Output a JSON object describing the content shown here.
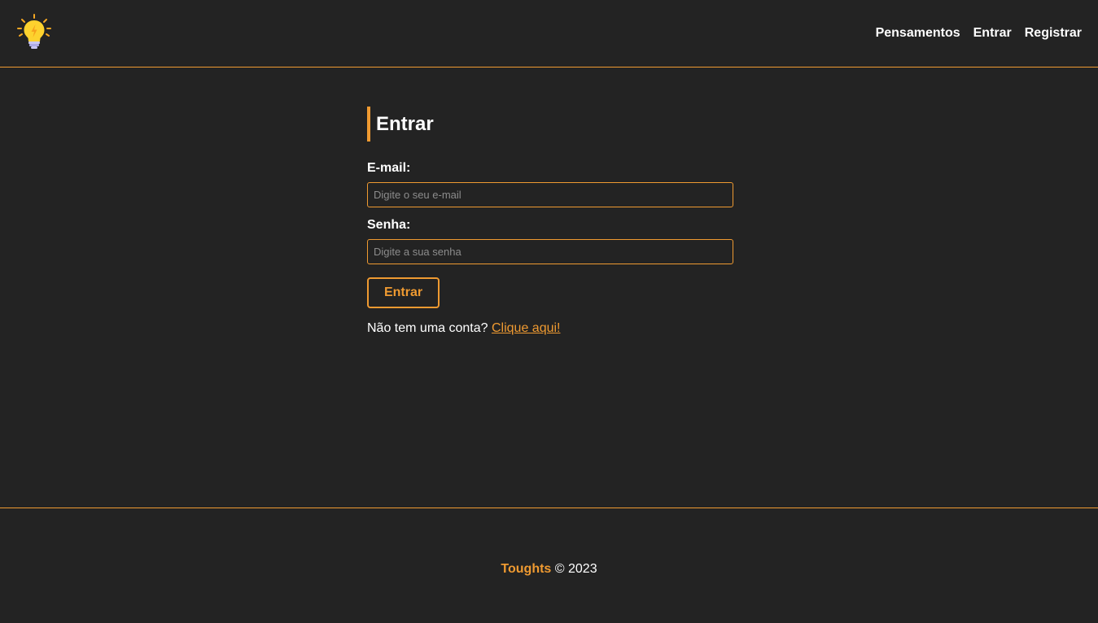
{
  "header": {
    "logo_icon": "lightbulb-icon",
    "nav": [
      {
        "label": "Pensamentos"
      },
      {
        "label": "Entrar"
      },
      {
        "label": "Registrar"
      }
    ]
  },
  "form": {
    "title": "Entrar",
    "email_label": "E-mail:",
    "email_placeholder": "Digite o seu e-mail",
    "email_value": "",
    "password_label": "Senha:",
    "password_placeholder": "Digite a sua senha",
    "password_value": "",
    "submit_label": "Entrar",
    "signup_text": "Não tem uma conta?",
    "signup_link": "Clique aqui!"
  },
  "footer": {
    "brand": "Toughts",
    "copyright": "© 2023"
  },
  "colors": {
    "background": "#232323",
    "accent": "#ef9a31",
    "text": "#ffffff",
    "placeholder": "#8c8c8c"
  }
}
